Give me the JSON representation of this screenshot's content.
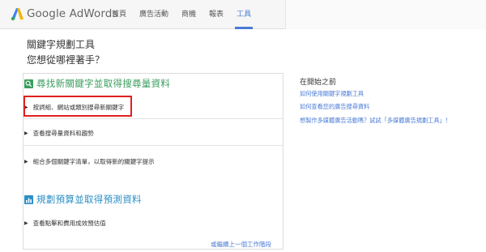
{
  "header": {
    "logo_text": "Google AdWords",
    "nav": [
      "首頁",
      "廣告活動",
      "商機",
      "報表",
      "工具"
    ],
    "active_nav": "工具"
  },
  "main": {
    "title": "關鍵字規劃工具",
    "subtitle": "您想從哪裡著手？",
    "sections": [
      {
        "title": "尋找新關鍵字並取得搜尋量資料",
        "options": [
          "按詞組、網站或類別搜尋新關鍵字",
          "查看搜尋量資料和趨勢",
          "組合多個關鍵字清單，以取得新的關鍵字提示"
        ]
      },
      {
        "title": "規劃預算並取得預測資料",
        "options": [
          "查看點擊和費用成效預估值"
        ]
      }
    ],
    "footer_link": "或繼續上一個工作階段"
  },
  "sidebar": {
    "title": "在開始之前",
    "links": [
      "如何使用關鍵字規劃工具",
      "如何查看您的廣告搜尋資料",
      "想製作多媒體廣告活動嗎？試試「多媒體廣告規劃工具」！"
    ]
  },
  "colors": {
    "accent": "#4a7bd6",
    "section1": "#3a9d5d",
    "section2": "#2c8fc4",
    "highlight": "#e02020"
  }
}
